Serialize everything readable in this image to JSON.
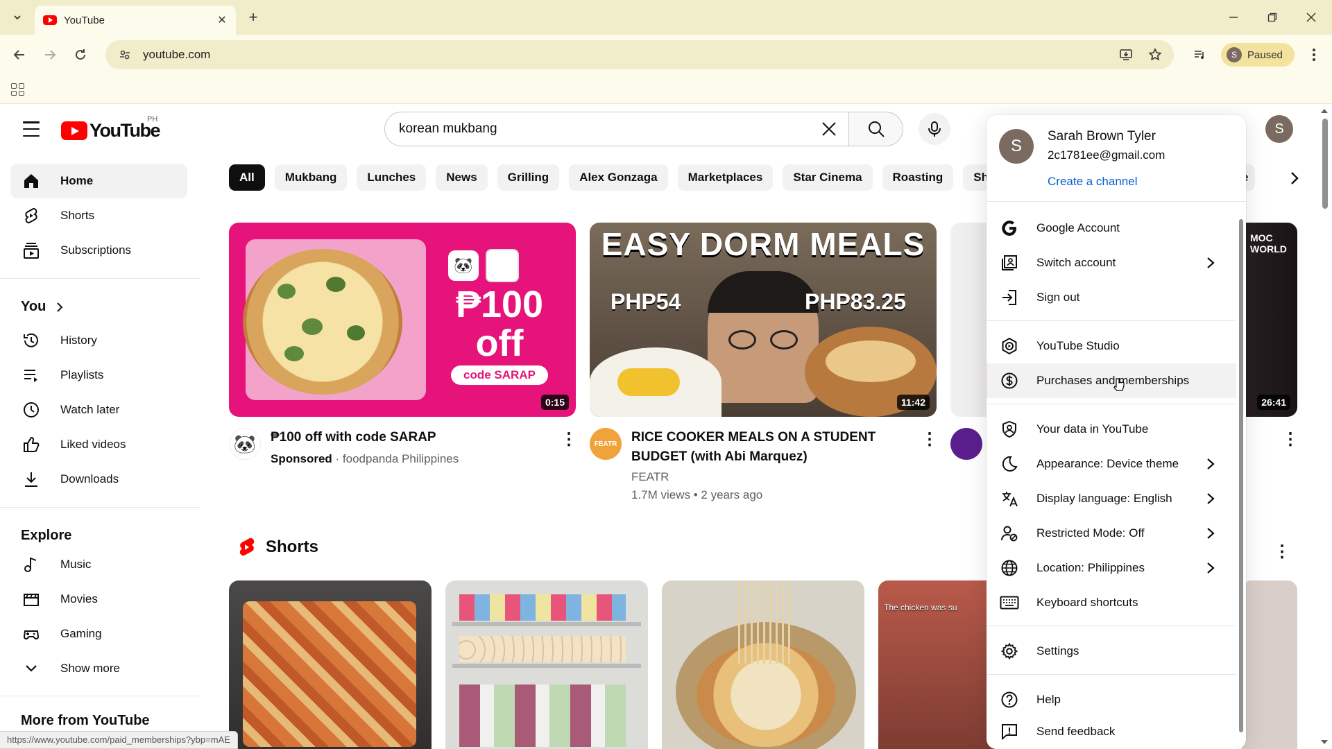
{
  "browser": {
    "tab_title": "YouTube",
    "url": "youtube.com",
    "profile_label": "Paused",
    "profile_initial": "S"
  },
  "masthead": {
    "logo_text": "YouTube",
    "region": "PH",
    "search_value": "korean mukbang",
    "avatar_initial": "S"
  },
  "sidebar": {
    "main": [
      {
        "label": "Home",
        "icon": "home-icon"
      },
      {
        "label": "Shorts",
        "icon": "shorts-icon"
      },
      {
        "label": "Subscriptions",
        "icon": "subscriptions-icon"
      }
    ],
    "you_heading": "You",
    "you": [
      {
        "label": "History",
        "icon": "history-icon"
      },
      {
        "label": "Playlists",
        "icon": "playlists-icon"
      },
      {
        "label": "Watch later",
        "icon": "watch-later-icon"
      },
      {
        "label": "Liked videos",
        "icon": "like-icon"
      },
      {
        "label": "Downloads",
        "icon": "download-icon"
      }
    ],
    "explore_heading": "Explore",
    "explore": [
      {
        "label": "Music",
        "icon": "music-icon"
      },
      {
        "label": "Movies",
        "icon": "movies-icon"
      },
      {
        "label": "Gaming",
        "icon": "gaming-icon"
      },
      {
        "label": "Show more",
        "icon": "chevron-down-icon"
      }
    ],
    "more_heading": "More from YouTube"
  },
  "chips": [
    "All",
    "Mukbang",
    "Lunches",
    "News",
    "Grilling",
    "Alex Gonzaga",
    "Marketplaces",
    "Star Cinema",
    "Roasting",
    "Shop"
  ],
  "chip_partial_right": "e",
  "videos": [
    {
      "title": "₱100 off with code SARAP",
      "sponsored": "Sponsored",
      "channel": "foodpanda Philippines",
      "duration": "0:15",
      "thumb_big": "₱100",
      "thumb_off": "off",
      "thumb_code": "code SARAP"
    },
    {
      "title_line1": "RICE COOKER MEALS ON A STUDENT",
      "title_line2": "BUDGET (with Abi Marquez)",
      "channel": "FEATR",
      "meta": "1.7M views • 2 years ago",
      "duration": "11:42",
      "thumb_title": "EASY DORM MEALS",
      "price_left": "PHP54",
      "price_right": "PHP83.25"
    },
    {
      "duration": "26:41",
      "badge": "MOC WORLD"
    }
  ],
  "shorts": {
    "title": "Shorts",
    "caption_4": "The chicken was su"
  },
  "account_menu": {
    "name": "Sarah Brown Tyler",
    "email": "2c1781ee@gmail.com",
    "create_channel": "Create a channel",
    "initial": "S",
    "items": [
      {
        "label": "Google Account",
        "icon": "google-icon"
      },
      {
        "label": "Switch account",
        "icon": "switch-account-icon"
      },
      {
        "label": "Sign out",
        "icon": "sign-out-icon"
      },
      {
        "label": "YouTube Studio",
        "icon": "studio-icon"
      },
      {
        "label": "Purchases and memberships",
        "icon": "dollar-icon"
      },
      {
        "label": "Your data in YouTube",
        "icon": "shield-user-icon"
      },
      {
        "label": "Appearance: Device theme",
        "icon": "moon-icon"
      },
      {
        "label": "Display language: English",
        "icon": "translate-icon"
      },
      {
        "label": "Restricted Mode: Off",
        "icon": "restricted-icon"
      },
      {
        "label": "Location: Philippines",
        "icon": "globe-icon"
      },
      {
        "label": "Keyboard shortcuts",
        "icon": "keyboard-icon"
      },
      {
        "label": "Settings",
        "icon": "gear-icon"
      },
      {
        "label": "Help",
        "icon": "help-icon"
      },
      {
        "label": "Send feedback",
        "icon": "feedback-icon"
      }
    ]
  },
  "status_url": "https://www.youtube.com/paid_memberships?ybp=mAE",
  "colors": {
    "accent": "#ff0000",
    "link": "#065fd4",
    "chrome": "#f1ecc9"
  }
}
